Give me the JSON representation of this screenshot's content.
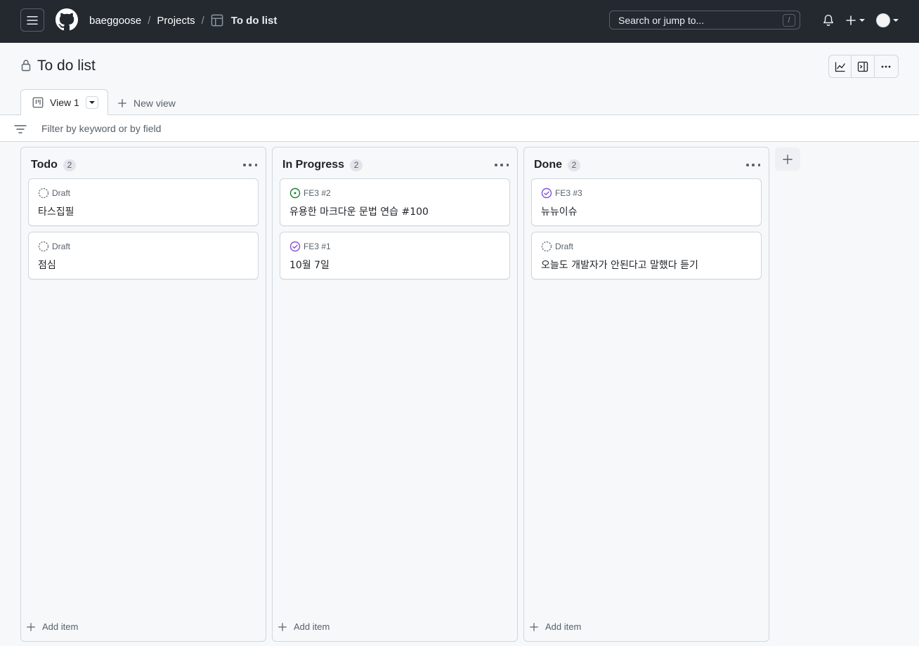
{
  "header": {
    "owner": "baeggoose",
    "projects_link": "Projects",
    "current_project": "To do list",
    "separator": "/",
    "search_placeholder": "Search or jump to...",
    "search_shortcut": "/"
  },
  "project": {
    "title": "To do list",
    "views": [
      {
        "label": "View 1"
      }
    ],
    "new_view_label": "New view",
    "filter_placeholder": "Filter by keyword or by field"
  },
  "columns": [
    {
      "title": "Todo",
      "count": "2",
      "add_item_label": "Add item",
      "cards": [
        {
          "meta": "Draft",
          "status": "draft",
          "title": "타스집필"
        },
        {
          "meta": "Draft",
          "status": "draft",
          "title": "점심"
        }
      ]
    },
    {
      "title": "In Progress",
      "count": "2",
      "add_item_label": "Add item",
      "cards": [
        {
          "meta": "FE3 #2",
          "status": "open",
          "title": "유용한 마크다운 문법 연습 #100"
        },
        {
          "meta": "FE3 #1",
          "status": "done",
          "title": "10월 7일"
        }
      ]
    },
    {
      "title": "Done",
      "count": "2",
      "add_item_label": "Add item",
      "cards": [
        {
          "meta": "FE3 #3",
          "status": "done",
          "title": "뉴뉴이슈"
        },
        {
          "meta": "Draft",
          "status": "draft",
          "title": "오늘도 개발자가 안된다고 말했다 듣기"
        }
      ]
    }
  ],
  "icons": {
    "menu": "hamburger-icon",
    "logo": "github-logo-icon",
    "table": "table-icon",
    "bell": "bell-icon",
    "plus": "plus-icon",
    "lock": "lock-icon",
    "insights": "graph-icon",
    "sidepanel": "sidebar-expand-icon",
    "more": "kebab-horizontal-icon",
    "board": "project-board-icon",
    "filter": "filter-icon"
  },
  "colors": {
    "header_bg": "#24292f",
    "open_green": "#1a7f37",
    "done_purple": "#8250df",
    "draft_gray": "#57606a"
  }
}
